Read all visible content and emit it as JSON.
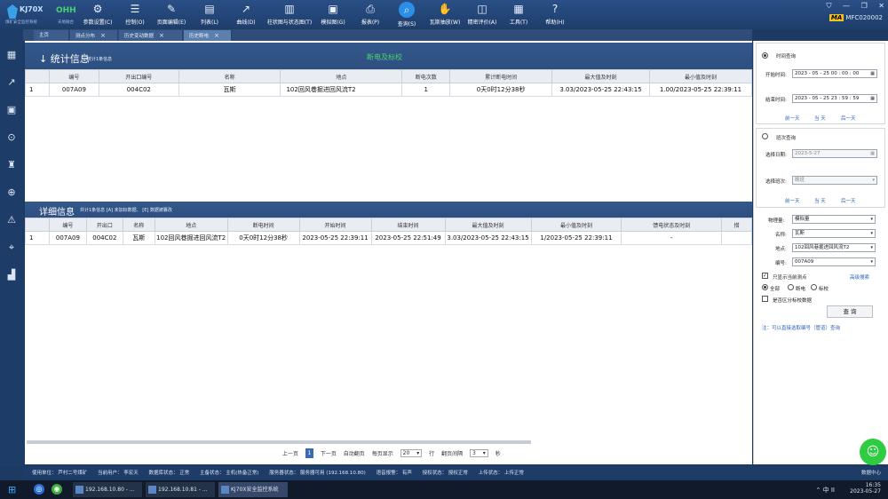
{
  "brand": {
    "name": "KJ70X",
    "subtitle": "煤矿安全监控系统",
    "partner": "OHH",
    "partner_sub": "天地融合"
  },
  "toolbar": [
    {
      "label": "参数设置(C)",
      "icon": "gear-grid-icon"
    },
    {
      "label": "控制(O)",
      "icon": "sliders-icon"
    },
    {
      "label": "页面编辑(E)",
      "icon": "edit-icon"
    },
    {
      "label": "列表(L)",
      "icon": "list-icon"
    },
    {
      "label": "曲线(D)",
      "icon": "line-chart-icon"
    },
    {
      "label": "柱状图与状态图(T)",
      "icon": "bar-chart-icon"
    },
    {
      "label": "模拟图(G)",
      "icon": "image-icon"
    },
    {
      "label": "报表(P)",
      "icon": "print-icon"
    },
    {
      "label": "查询(S)",
      "icon": "search-icon"
    },
    {
      "label": "瓦斯抽放(W)",
      "icon": "hand-icon"
    },
    {
      "label": "精密评价(A)",
      "icon": "chart-eval-icon"
    },
    {
      "label": "工具(T)",
      "icon": "toolbox-icon"
    },
    {
      "label": "帮助(H)",
      "icon": "help-icon"
    }
  ],
  "header_right": {
    "badge": "MA",
    "code": "MFC020002"
  },
  "tabs": [
    {
      "label": "主页",
      "closable": false
    },
    {
      "label": "测点分布",
      "closable": true
    },
    {
      "label": "历史变动数据",
      "closable": true
    },
    {
      "label": "历史断电",
      "closable": true
    }
  ],
  "stats": {
    "title": "统计信息",
    "count_text": "统计1条信息",
    "center_label": "断电及标校",
    "columns": [
      "",
      "编号",
      "开出口编号",
      "名称",
      "地点",
      "断电次数",
      "累计断电时间",
      "最大值及时刻",
      "最小值及时刻"
    ],
    "rows": [
      [
        "1",
        "007A09",
        "004C02",
        "瓦斯",
        "102回风巷掘进回风流T2",
        "1",
        "0天0时12分38秒",
        "3.03/2023-05-25 22:43:15",
        "1.00/2023-05-25 22:39:11"
      ]
    ]
  },
  "detail": {
    "title": "详细信息",
    "count_text": "共计1条信息 [A] 未加标数据、 [E] 数据被篡改",
    "columns": [
      "",
      "编号",
      "开出口",
      "名称",
      "地点",
      "断电时间",
      "开始时间",
      "结束时间",
      "最大值及时刻",
      "最小值及时刻",
      "馈电状态及时刻",
      "措"
    ],
    "rows": [
      [
        "1",
        "007A09",
        "004C02",
        "瓦斯",
        "102回风巷掘进回风流T2",
        "0天0时12分38秒",
        "2023-05-25 22:39:11",
        "2023-05-25 22:51:49",
        "3.03/2023-05-25 22:43:15",
        "1/2023-05-25 22:39:11",
        "-",
        ""
      ]
    ]
  },
  "pager": {
    "prev": "上一页",
    "page": "1",
    "next": "下一页",
    "auto": "自动翻页",
    "per_page_label": "每页显示",
    "per_page": "20",
    "unit_row": "行",
    "interval_label": "翻页间隔",
    "interval": "3",
    "unit_sec": "秒"
  },
  "query_panel": {
    "time_query": "时间查询",
    "start_label": "开始时间:",
    "start_value": "2023 - 05 - 25  00 : 00 : 00",
    "end_label": "结束时间:",
    "end_value": "2023 - 05 - 25  23 : 59 : 59",
    "quick_links_1": [
      "前一天",
      "当 天",
      "后一天"
    ],
    "shift_query": "班次查询",
    "date_label": "选择日期:",
    "date_value": "2023-5-27",
    "shift_label": "选择班次:",
    "shift_value": "晚班",
    "quick_links_2": [
      "前一天",
      "当 天",
      "后一天"
    ],
    "quantity_label": "物理量:",
    "quantity_value": "模拟量",
    "name_label": "名称:",
    "name_value": "瓦斯",
    "place_label": "地点:",
    "place_value": "102回风巷掘进回风流T2",
    "code_label": "编号:",
    "code_value": "007A09",
    "only_current": "只显示当前测点",
    "advanced": "高级搜索",
    "filter_all": "全部",
    "filter_cut": "断电",
    "filter_cal": "标校",
    "split_cal": "是否区分标校数据",
    "query_button": "查 询",
    "note": "注：可以直接选取编号（管道）查询"
  },
  "statusbar": [
    "使用单位： 芦村二号煤矿",
    "当前用户： 李宏天",
    "数据库状态： 正常",
    "主备状态： 主机(热备正常)",
    "服务器状态： 服务器可用 (192.168.10.80)",
    "语音报警： 有声",
    "授权状态： 授权正常",
    "上传状态： 上传正常"
  ],
  "statusbar_right": "数据中心",
  "taskbar": {
    "apps": [
      "192.168.10.80 - ...",
      "192.168.10.81 - ...",
      "KJ70X安全监控系统"
    ],
    "time": "16:35",
    "date": "2023-05-27",
    "tray": "中 ⅠⅠ"
  },
  "colors": {
    "accent": "#2b8fe8",
    "green": "#4bd06f",
    "header": "#2d4f80"
  }
}
